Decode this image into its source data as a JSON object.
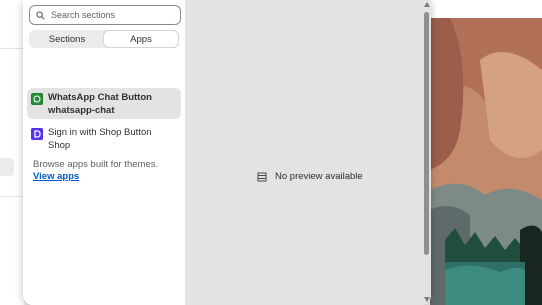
{
  "search": {
    "placeholder": "Search sections"
  },
  "tabs": [
    {
      "label": "Sections",
      "active": false
    },
    {
      "label": "Apps",
      "active": true
    }
  ],
  "apps": [
    {
      "title": "WhatsApp Chat Button",
      "subtitle": "whatsapp-chat",
      "selected": true,
      "icon": "whatsapp-icon",
      "icon_color": "#25a244"
    },
    {
      "title": "Sign in with Shop Button",
      "subtitle": "Shop",
      "selected": false,
      "icon": "shop-icon",
      "icon_color": "#5a31f4"
    }
  ],
  "browse": {
    "text": "Browse apps built for themes.",
    "link": "View apps"
  },
  "preview": {
    "message": "No preview available"
  },
  "colors": {
    "link": "#005bd3",
    "selected_bg": "#e3e3e3",
    "preview_bg": "#e3e3e3"
  }
}
